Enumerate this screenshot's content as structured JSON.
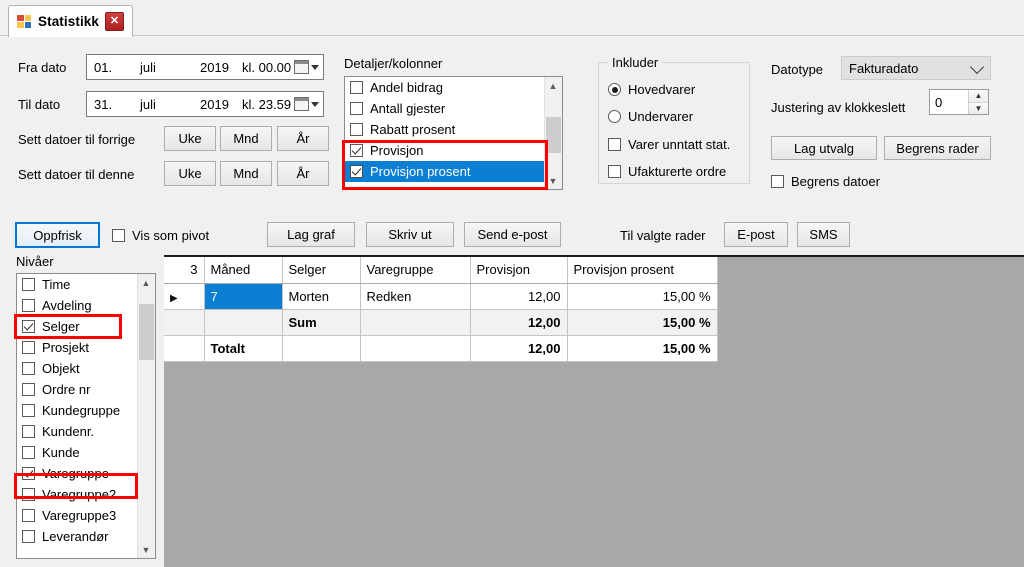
{
  "tab": {
    "title": "Statistikk",
    "close_label": "✕",
    "icon": "forms-app-icon",
    "close_icon": "close-icon"
  },
  "dates": {
    "fra_label": "Fra dato",
    "til_label": "Til dato",
    "fra": {
      "day": "01.",
      "month": "juli",
      "year": "2019",
      "time": "kl. 00.00"
    },
    "til": {
      "day": "31.",
      "month": "juli",
      "year": "2019",
      "time": "kl. 23.59"
    },
    "prev_label": "Sett datoer til forrige",
    "this_label": "Sett datoer til denne",
    "period_buttons": [
      "Uke",
      "Mnd",
      "År"
    ]
  },
  "details": {
    "title": "Detaljer/kolonner",
    "items": [
      {
        "label": "Andel bidrag",
        "checked": false,
        "selected": false
      },
      {
        "label": "Antall gjester",
        "checked": false,
        "selected": false
      },
      {
        "label": "Rabatt prosent",
        "checked": false,
        "selected": false
      },
      {
        "label": "Provisjon",
        "checked": true,
        "selected": false
      },
      {
        "label": "Provisjon prosent",
        "checked": true,
        "selected": true
      }
    ]
  },
  "inkluder": {
    "title": "Inkluder",
    "radios": [
      {
        "label": "Hovedvarer",
        "checked": true
      },
      {
        "label": "Undervarer",
        "checked": false
      }
    ],
    "checks": [
      {
        "label": "Varer unntatt stat.",
        "checked": false
      },
      {
        "label": "Ufakturerte ordre",
        "checked": false
      }
    ]
  },
  "rightpanel": {
    "datotype_label": "Datotype",
    "datotype_value": "Fakturadato",
    "justering_label": "Justering av klokkeslett",
    "justering_value": "0",
    "lag_utvalg": "Lag utvalg",
    "begrens_rader": "Begrens rader",
    "begrens_datoer": "Begrens datoer",
    "begrens_datoer_checked": false
  },
  "toolbar": {
    "oppfrisk": "Oppfrisk",
    "vis_som_pivot": "Vis som pivot",
    "vis_som_pivot_checked": false,
    "lag_graf": "Lag graf",
    "skriv_ut": "Skriv ut",
    "send_epost": "Send e-post",
    "til_valgte_rader": "Til valgte rader",
    "epost": "E-post",
    "sms": "SMS"
  },
  "nivaer": {
    "title": "Nivåer",
    "items": [
      {
        "label": "Time",
        "checked": false
      },
      {
        "label": "Avdeling",
        "checked": false
      },
      {
        "label": "Selger",
        "checked": true
      },
      {
        "label": "Prosjekt",
        "checked": false
      },
      {
        "label": "Objekt",
        "checked": false
      },
      {
        "label": "Ordre nr",
        "checked": false
      },
      {
        "label": "Kundegruppe",
        "checked": false
      },
      {
        "label": "Kundenr.",
        "checked": false
      },
      {
        "label": "Kunde",
        "checked": false
      },
      {
        "label": "Varegruppe",
        "checked": true
      },
      {
        "label": "Varegruppe2",
        "checked": false
      },
      {
        "label": "Varegruppe3",
        "checked": false
      },
      {
        "label": "Leverandør",
        "checked": false
      }
    ]
  },
  "grid": {
    "corner": "3",
    "columns": [
      "Måned",
      "Selger",
      "Varegruppe",
      "Provisjon",
      "Provisjon prosent"
    ],
    "rows": [
      {
        "kind": "data",
        "marker": "▶",
        "cells": [
          "7",
          "Morten",
          "Redken",
          "12,00",
          "15,00 %"
        ]
      },
      {
        "kind": "sum",
        "marker": "",
        "cells": [
          "",
          "Sum",
          "",
          "12,00",
          "15,00 %"
        ]
      },
      {
        "kind": "total",
        "marker": "",
        "cells": [
          "Totalt",
          "",
          "",
          "12,00",
          "15,00 %"
        ]
      }
    ]
  },
  "colors": {
    "accent": "#0b7fd4",
    "annotation": "#ff0000",
    "grid_background": "#a8a8a8",
    "window_background": "#f0f0f0"
  }
}
